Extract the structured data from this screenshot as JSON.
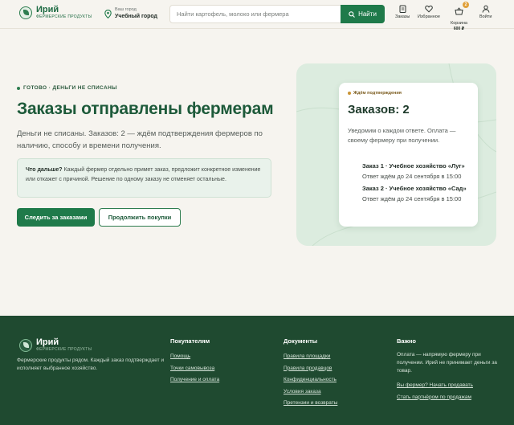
{
  "header": {
    "logo_name": "Ирий",
    "logo_sub": "ФЕРМЕРСКИЕ ПРОДУКТЫ",
    "city_label": "Ваш город",
    "city_name": "Учебный город",
    "search_placeholder": "Найти картофель, молоко или фермера",
    "search_button": "Найти",
    "nav": {
      "orders": "Заказы",
      "favorites": "Избранное",
      "cart": "Корзина",
      "cart_count": "2",
      "cart_price": "600 ₽",
      "login": "Войти"
    }
  },
  "hero": {
    "status": "ГОТОВО · ДЕНЬГИ НЕ СПИСАНЫ",
    "title": "Заказы отправлены фермерам",
    "lead": "Деньги не списаны. Заказов: 2 — ждём подтверждения фермеров по наличию, способу и времени получения.",
    "note_bold": "Что дальше?",
    "note_text": " Каждый фермер отдельно примет заказ, предложит конкретное изменение или откажет с причиной. Решение по одному заказу не отменяет остальные.",
    "primary_button": "Следить за заказами",
    "secondary_button": "Продолжить покупки"
  },
  "card": {
    "status": "Ждём подтверждения",
    "title": "Заказов: 2",
    "text": "Уведомим о каждом ответе. Оплата — своему фермеру при получении.",
    "orders": [
      {
        "name": "Заказ 1 · Учебное хозяйство «Луг»",
        "eta": "Ответ ждём до 24 сентября в 15:00"
      },
      {
        "name": "Заказ 2 · Учебное хозяйство «Сад»",
        "eta": "Ответ ждём до 24 сентября в 15:00"
      }
    ]
  },
  "footer": {
    "logo_name": "Ирий",
    "logo_sub": "ФЕРМЕРСКИЕ ПРОДУКТЫ",
    "desc": "Фермерские продукты рядом. Каждый заказ подтверждает и исполняет выбранное хозяйство.",
    "col1_title": "Покупателям",
    "col1_links": [
      "Помощь",
      "Точки самовывоза",
      "Получение и оплата"
    ],
    "col2_title": "Документы",
    "col2_links": [
      "Правила площадки",
      "Правила продавцов",
      "Конфиденциальность",
      "Условия заказа",
      "Претензии и возвраты"
    ],
    "col3_title": "Важно",
    "col3_text": "Оплата — напрямую фермеру при получении. Ирий не принимает деньги за товар.",
    "col3_links": [
      "Вы фермер? Начать продавать",
      "Стать партнёром по продажам"
    ]
  },
  "colors": {
    "accent": "#1f7a4a",
    "title": "#1d5a3a",
    "footer_bg": "#1f4a30",
    "badge": "#e0a03a",
    "page_bg": "#f6f4ef"
  }
}
